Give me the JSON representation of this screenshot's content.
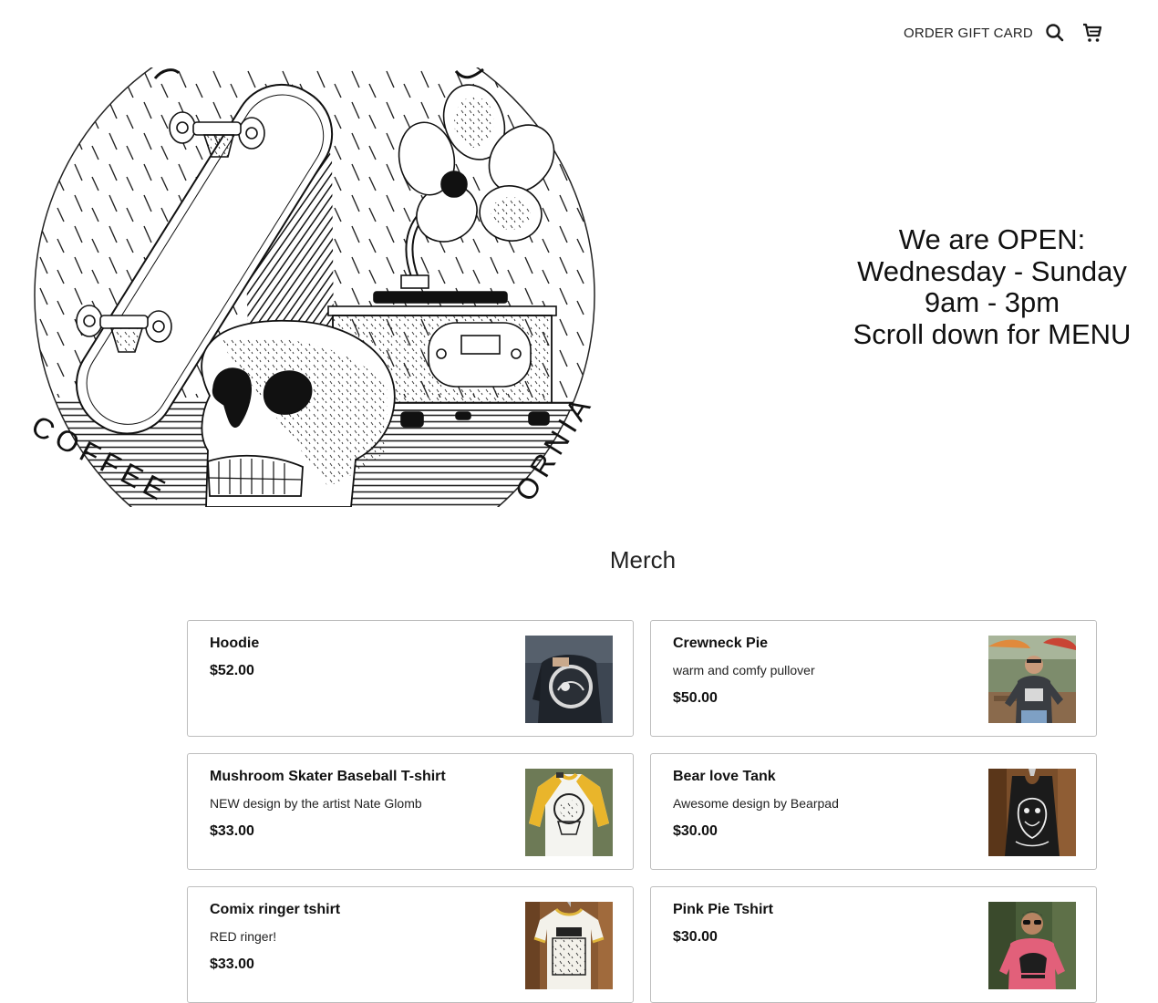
{
  "header": {
    "gift_card_label": "ORDER GIFT CARD",
    "search_icon": "search-icon",
    "cart_icon": "cart-icon"
  },
  "hero": {
    "logo_text_left": "COFFEE",
    "logo_text_right": "ORNIA"
  },
  "hours": {
    "line1": "We are OPEN:",
    "line2": "Wednesday - Sunday",
    "line3": "9am - 3pm",
    "line4": "Scroll down for MENU"
  },
  "merch": {
    "title": "Merch",
    "items": [
      {
        "name": "Hoodie",
        "description": "",
        "price": "$52.00",
        "photo": "black hoodie back print"
      },
      {
        "name": "Crewneck Pie",
        "description": "warm and comfy pullover",
        "price": "$50.00",
        "photo": "person wearing crewneck"
      },
      {
        "name": "Mushroom Skater Baseball T-shirt",
        "description": "NEW design by the artist Nate Glomb",
        "price": "$33.00",
        "photo": "raglan baseball tee"
      },
      {
        "name": "Bear love Tank",
        "description": "Awesome design by Bearpad",
        "price": "$30.00",
        "photo": "black tank top"
      },
      {
        "name": "Comix ringer tshirt",
        "description": "RED ringer!",
        "price": "$33.00",
        "photo": "ringer tshirt"
      },
      {
        "name": "Pink Pie Tshirt",
        "description": "",
        "price": "$30.00",
        "photo": "person wearing pink tshirt"
      }
    ]
  },
  "colors": {
    "text": "#111111",
    "border": "#bdbdbd",
    "background": "#ffffff"
  }
}
